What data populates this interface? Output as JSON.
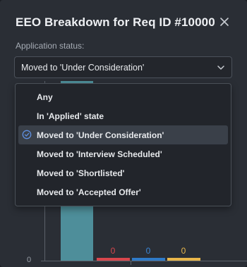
{
  "modal": {
    "title": "EEO Breakdown for Req ID #10000",
    "close_icon": "close-icon"
  },
  "filter": {
    "label": "Application status:",
    "selected_value": "Moved to 'Under Consideration'",
    "chevron_icon": "chevron-down-icon"
  },
  "dropdown": {
    "options": [
      {
        "label": "Any",
        "selected": false
      },
      {
        "label": "In 'Applied' state",
        "selected": false
      },
      {
        "label": "Moved to 'Under Consideration'",
        "selected": true
      },
      {
        "label": "Moved to 'Interview Scheduled'",
        "selected": false
      },
      {
        "label": "Moved to 'Shortlisted'",
        "selected": false
      },
      {
        "label": "Moved to 'Accepted Offer'",
        "selected": false
      }
    ],
    "check_icon": "check-circle-icon"
  },
  "chart_data": {
    "type": "bar",
    "y_tick_labels": [
      "0"
    ],
    "bars": [
      {
        "value": null,
        "color": "#4e8e9a",
        "label": ""
      },
      {
        "value": 0,
        "color": "#d8464c",
        "label": "0"
      },
      {
        "value": 0,
        "color": "#2f7ac7",
        "label": "0"
      },
      {
        "value": 0,
        "color": "#e8b64a",
        "label": "0"
      }
    ],
    "ylabel": "",
    "xlabel": "",
    "title": ""
  }
}
